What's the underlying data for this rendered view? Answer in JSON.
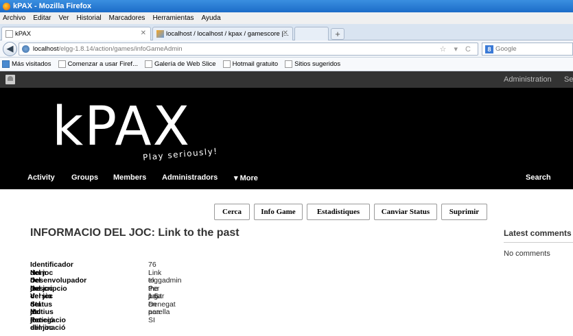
{
  "window": {
    "title": "kPAX - Mozilla Firefox"
  },
  "menubar": [
    "Archivo",
    "Editar",
    "Ver",
    "Historial",
    "Marcadores",
    "Herramientas",
    "Ayuda"
  ],
  "tabs": [
    {
      "label": "kPAX",
      "icon": "blank-page-icon"
    },
    {
      "label": "localhost / localhost / kpax / gamescore |...",
      "icon": "phpmyadmin-icon"
    },
    {
      "label": "http://www.google.es/",
      "icon": "warning-icon"
    }
  ],
  "navbar": {
    "url_host": "localhost",
    "url_path": "/elgg-1.8.14/action/games/infoGameAdmin",
    "search_placeholder": "Google"
  },
  "bookmarks": [
    "Más visitados",
    "Comenzar a usar Firef...",
    "Galería de Web Slice",
    "Hotmail gratuito",
    "Sitios sugeridos"
  ],
  "topbar": {
    "admin": "Administration",
    "settings_partial": "Se"
  },
  "site": {
    "logo": "kPAX",
    "tagline": "Play seriously!",
    "nav": [
      "Activity",
      "Groups",
      "Members",
      "Administradors",
      "▾ More"
    ],
    "search": "Search"
  },
  "buttons": [
    "Cerca",
    "Info Game",
    "Estadistiques",
    "Canviar Status",
    "Suprimir"
  ],
  "page_title": "INFORMACIO DEL JOC: Link to the past",
  "sidebar": {
    "heading": "Latest comments",
    "body": "No comments"
  },
  "info": [
    {
      "key": "Identificador del joc",
      "value": "76"
    },
    {
      "key": "Nom del joc",
      "value": "Link to the past"
    },
    {
      "key": "Desenvolupador del joc",
      "value": "elggadmin"
    },
    {
      "key": "Descripcio del joc",
      "value": "Per jugar en parella"
    },
    {
      "key": "Versio del joc",
      "value": "1.5"
    },
    {
      "key": "Status del joc",
      "value": "Denegat"
    },
    {
      "key": "Motius denegacio del joc",
      "value": "aea"
    },
    {
      "key": "Petició eliminació",
      "value": "SI"
    }
  ]
}
